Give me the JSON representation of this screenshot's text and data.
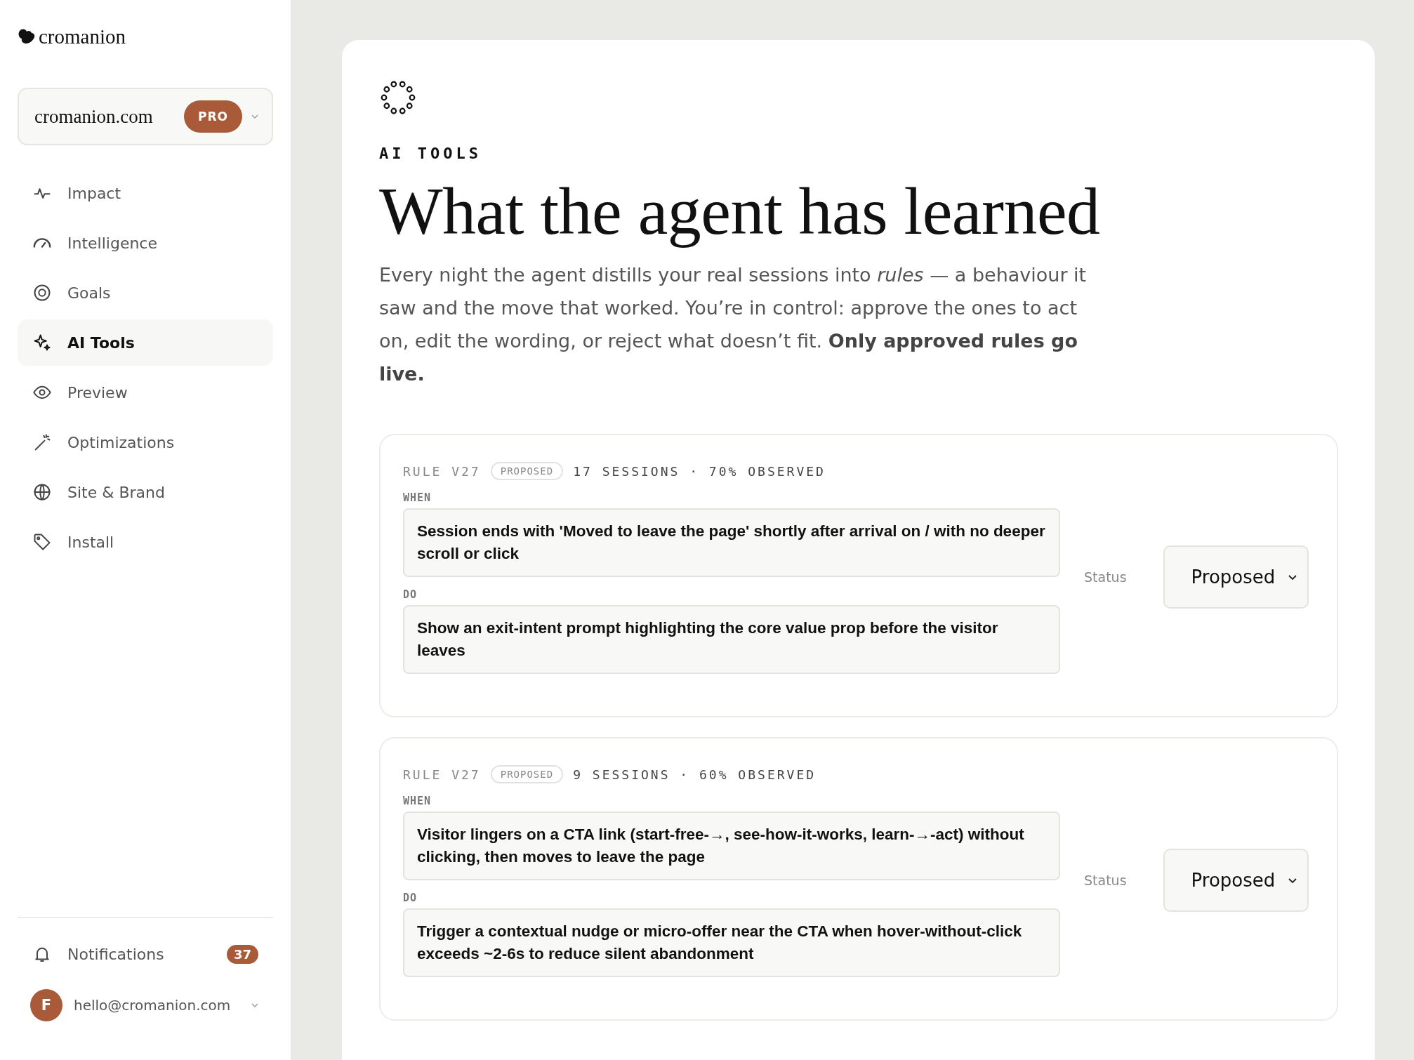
{
  "brand": {
    "name": "cromanion"
  },
  "site_switcher": {
    "name": "cromanion.com",
    "plan": "PRO"
  },
  "nav": [
    {
      "label": "Impact",
      "selected": false
    },
    {
      "label": "Intelligence",
      "selected": false
    },
    {
      "label": "Goals",
      "selected": false
    },
    {
      "label": "AI Tools",
      "selected": true
    },
    {
      "label": "Preview",
      "selected": false
    },
    {
      "label": "Optimizations",
      "selected": false
    },
    {
      "label": "Site & Brand",
      "selected": false
    },
    {
      "label": "Install",
      "selected": false
    }
  ],
  "notifications": {
    "label": "Notifications",
    "count": "37"
  },
  "account": {
    "initial": "F",
    "email": "hello@cromanion.com"
  },
  "page": {
    "eyebrow": "AI TOOLS",
    "title": "What the agent has learned",
    "intro": "Every night the agent distills your real sessions into *rules* — a behaviour it saw and the move that worked. You’re in control: approve the ones to act on, edit the wording, or reject what doesn’t fit. **Only approved rules go live.**"
  },
  "rules": [
    {
      "version": "RULE V27",
      "badge": "PROPOSED",
      "stats": "17 SESSIONS · 70% OBSERVED",
      "when_label": "WHEN",
      "when": "Session ends with 'Moved to leave the page' shortly after arrival on / with no deeper scroll or click",
      "do_label": "DO",
      "do": "Show an exit-intent prompt highlighting the core value prop before the visitor leaves",
      "status_label": "Status",
      "status": "Proposed"
    },
    {
      "version": "RULE V27",
      "badge": "PROPOSED",
      "stats": "9 SESSIONS · 60% OBSERVED",
      "when_label": "WHEN",
      "when": "Visitor lingers on a CTA link (start-free-→, see-how-it-works, learn-→-act) without clicking, then moves to leave the page",
      "do_label": "DO",
      "do": "Trigger a contextual nudge or micro-offer near the CTA when hover-without-click exceeds ~2-6s to reduce silent abandonment",
      "status_label": "Status",
      "status": "Proposed"
    }
  ]
}
